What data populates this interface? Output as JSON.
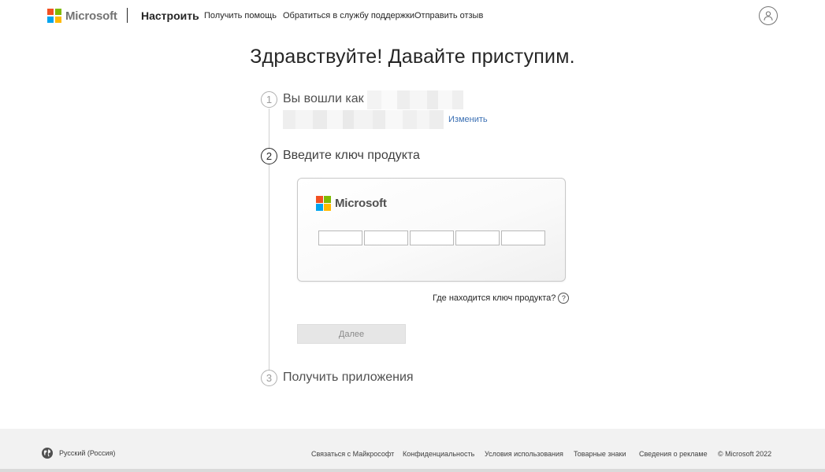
{
  "header": {
    "brand": "Microsoft",
    "title": "Настроить",
    "links": [
      "Получить помощь",
      "Обратиться в службу поддержки",
      "Отправить отзыв"
    ],
    "avatar_icon": "person-icon"
  },
  "main": {
    "heading": "Здравствуйте! Давайте приступим.",
    "steps": [
      {
        "number": "1",
        "label": "Вы вошли как",
        "change_label": "Изменить"
      },
      {
        "number": "2",
        "label": "Введите ключ продукта"
      },
      {
        "number": "3",
        "label": "Получить приложения"
      }
    ],
    "card": {
      "brand": "Microsoft",
      "key_inputs": [
        "",
        "",
        "",
        "",
        ""
      ]
    },
    "where_key_label": "Где находится ключ продукта?",
    "help_icon_glyph": "?",
    "next_label": "Далее"
  },
  "footer": {
    "locale": "Русский (Россия)",
    "links": [
      "Связаться с Майкрософт",
      "Конфиденциальность",
      "Условия использования",
      "Товарные знаки",
      "Сведения о рекламе"
    ],
    "copyright": "© Microsoft 2022"
  },
  "colors": {
    "ms_red": "#f25022",
    "ms_green": "#7fba00",
    "ms_blue": "#00a4ef",
    "ms_yellow": "#ffb900",
    "link_blue": "#3a6fb3"
  }
}
